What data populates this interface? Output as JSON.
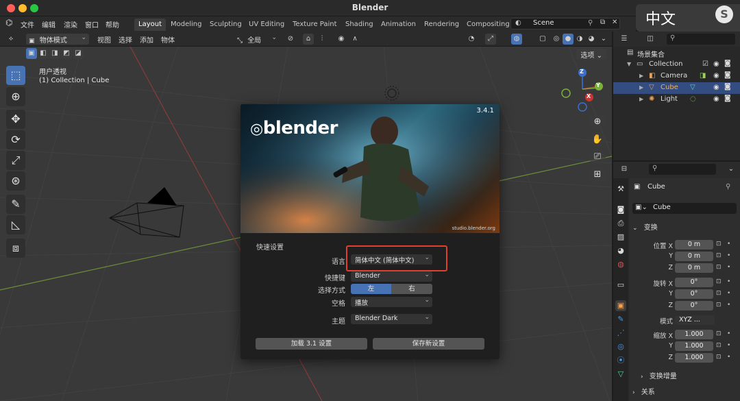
{
  "window": {
    "title": "Blender",
    "ime_label": "中文",
    "ime_logo": "S"
  },
  "colors": {
    "close": "#ff5f57",
    "minimize": "#febc2e",
    "zoom": "#28c840",
    "accent": "#4772b3",
    "highlight_box": "#e0402e",
    "selected_row": "#334d80"
  },
  "menu": {
    "items": [
      "文件",
      "编辑",
      "渲染",
      "窗口",
      "帮助"
    ]
  },
  "workspaces": [
    "Layout",
    "Modeling",
    "Sculpting",
    "UV Editing",
    "Texture Paint",
    "Shading",
    "Animation",
    "Rendering",
    "Compositing"
  ],
  "scene": {
    "name": "Scene"
  },
  "viewport_header": {
    "mode": "物体模式",
    "menu": [
      "视图",
      "选择",
      "添加",
      "物体"
    ],
    "transform_orientation": "全局",
    "options": "选项"
  },
  "viewport": {
    "view_name": "用户透视",
    "collection_info": "(1) Collection | Cube"
  },
  "gizmo": {
    "x": "X",
    "y": "Y",
    "z": "Z"
  },
  "splash": {
    "version": "3.4.1",
    "logo_text": "blender",
    "credit": "studio.blender.org",
    "quick_setup": "快速设置",
    "language_label": "语言",
    "language_value": "简体中文 (简体中文)",
    "keymap_label": "快捷键",
    "keymap_value": "Blender",
    "select_label": "选择方式",
    "select_left": "左",
    "select_right": "右",
    "space_label": "空格",
    "space_value": "播放",
    "theme_label": "主题",
    "theme_value": "Blender Dark",
    "load_button": "加载 3.1 设置",
    "save_button": "保存新设置"
  },
  "outliner": {
    "root": "场景集合",
    "rows": [
      {
        "name": "Collection"
      },
      {
        "name": "Camera"
      },
      {
        "name": "Cube"
      },
      {
        "name": "Light"
      }
    ]
  },
  "properties": {
    "object_name": "Cube",
    "object_field": "Cube",
    "transform_header": "变换",
    "location_label": "位置 X",
    "rotation_label": "旋转 X",
    "scale_label": "缩放 X",
    "y_label": "Y",
    "z_label": "Z",
    "location": [
      "0 m",
      "0 m",
      "0 m"
    ],
    "rotation": [
      "0°",
      "0°",
      "0°"
    ],
    "scale": [
      "1.000",
      "1.000",
      "1.000"
    ],
    "mode_label": "模式",
    "mode_value": "XYZ ...",
    "delta_header": "变换增量",
    "relations_header": "关系"
  }
}
